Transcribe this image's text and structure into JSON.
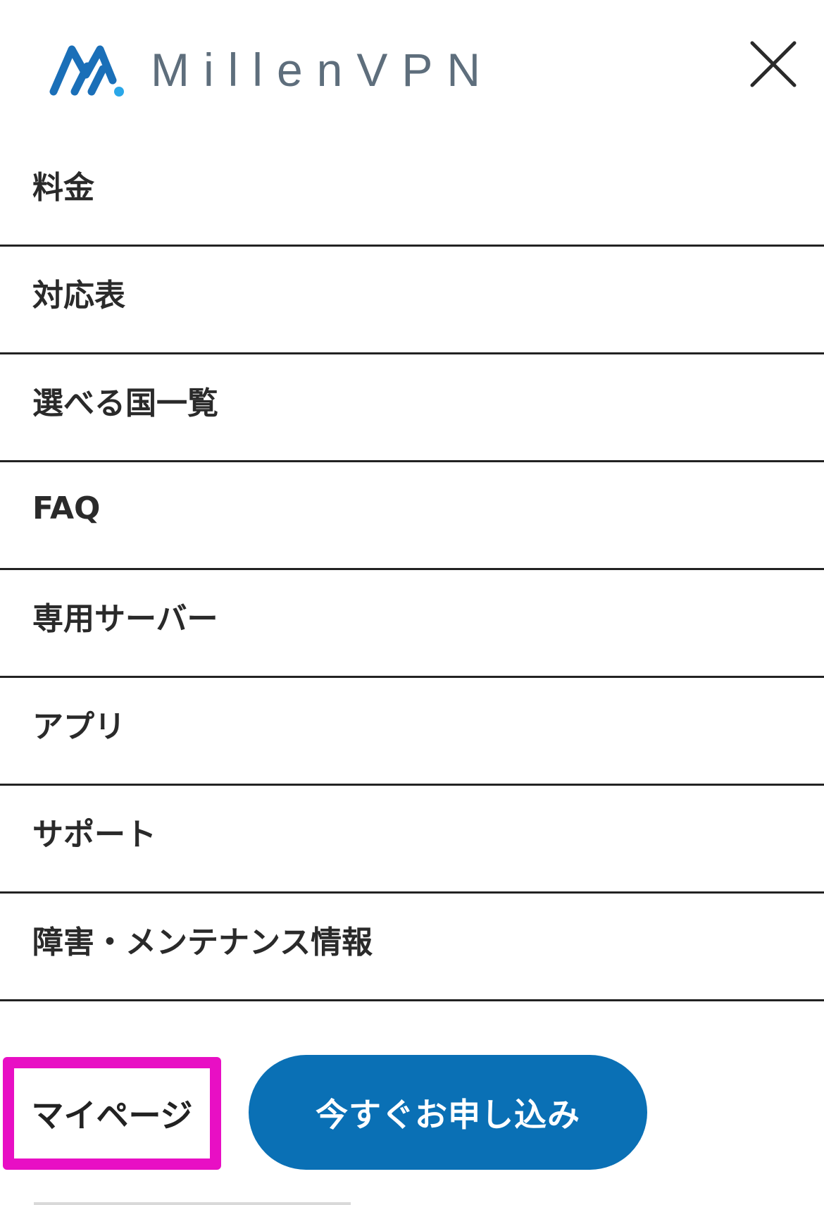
{
  "brand": {
    "name": "MillenVPN",
    "mark_color": "#1a6fb8",
    "dot_color": "#2aa7e8",
    "text_color": "#5e6e7c"
  },
  "header": {
    "close_icon": "close-icon"
  },
  "menu": {
    "items": [
      {
        "label": "料金"
      },
      {
        "label": "対応表"
      },
      {
        "label": "選べる国一覧"
      },
      {
        "label": "FAQ"
      },
      {
        "label": "専用サーバー"
      },
      {
        "label": "アプリ"
      },
      {
        "label": "サポート"
      },
      {
        "label": "障害・メンテナンス情報"
      }
    ]
  },
  "actions": {
    "mypage_label": "マイページ",
    "apply_label": "今すぐお申し込み",
    "apply_color": "#0a70b5",
    "highlight_color": "#e80fc4"
  }
}
